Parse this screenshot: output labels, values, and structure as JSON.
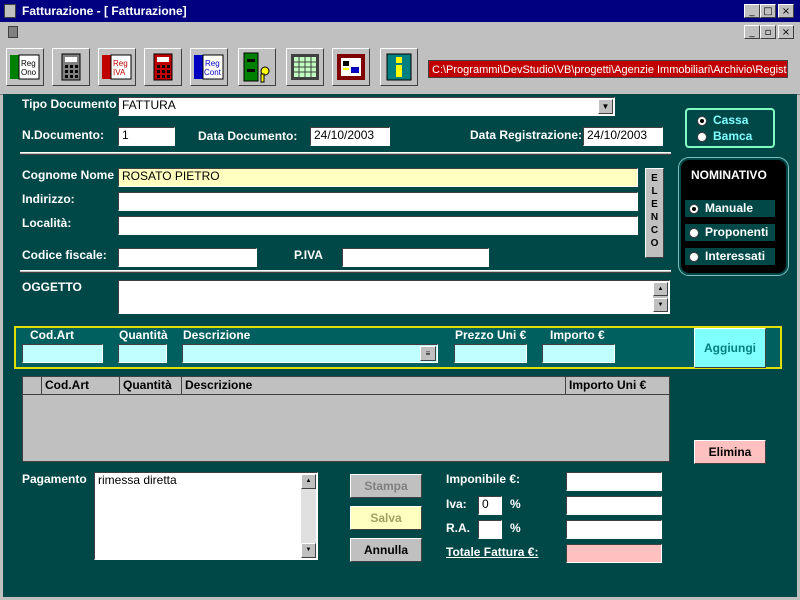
{
  "window": {
    "title": "Fatturazione - [ Fatturazione]",
    "min_glyph": "_",
    "max_glyph": "□",
    "close_glyph": "×",
    "restore_glyph": "▫"
  },
  "toolbar": {
    "path": "C:\\Programmi\\DevStudio\\VB\\progetti\\Agenzie Immobiliari\\Archivio\\Registr",
    "buttons": [
      {
        "name": "reg-ono",
        "label": "Reg Ono"
      },
      {
        "name": "calculator",
        "label": ""
      },
      {
        "name": "reg-iva",
        "label": "Reg IVA"
      },
      {
        "name": "calculator-red",
        "label": ""
      },
      {
        "name": "reg-cont",
        "label": "Reg Cont"
      },
      {
        "name": "archive",
        "label": ""
      },
      {
        "name": "calendar",
        "label": ""
      },
      {
        "name": "report",
        "label": ""
      },
      {
        "name": "info",
        "label": ""
      }
    ]
  },
  "header": {
    "tipo_documento_label": "Tipo Documento",
    "tipo_documento_value": "FATTURA",
    "n_documento_label": "N.Documento:",
    "n_documento_value": "1",
    "data_documento_label": "Data Documento:",
    "data_documento_value": "24/10/2003",
    "data_registrazione_label": "Data Registrazione:",
    "data_registrazione_value": "24/10/2003",
    "cassa_label": "Cassa",
    "banca_label": "Bamca"
  },
  "client": {
    "cognome_nome_label": "Cognome Nome",
    "cognome_nome_value": "ROSATO PIETRO",
    "indirizzo_label": "Indirizzo:",
    "localita_label": "Località:",
    "codice_fiscale_label": "Codice fiscale:",
    "piva_label": "P.IVA",
    "elenco_label": "ELENCO"
  },
  "nominativo": {
    "title": "NOMINATIVO",
    "options": [
      "Manuale",
      "Proponenti",
      "Interessati"
    ]
  },
  "oggetto": {
    "label": "OGGETTO"
  },
  "item_entry": {
    "cod_art_label": "Cod.Art",
    "quantita_label": "Quantità",
    "descrizione_label": "Descrizione",
    "prezzo_label": "Prezzo Uni €",
    "importo_label": "Importo €",
    "aggiungi_label": "Aggiungi"
  },
  "grid": {
    "columns": [
      "Cod.Art",
      "Quantità",
      "Descrizione",
      "Importo Uni €"
    ],
    "rows": []
  },
  "actions": {
    "elimina_label": "Elimina",
    "stampa_label": "Stampa",
    "salva_label": "Salva",
    "annulla_label": "Annulla"
  },
  "pagamento": {
    "label": "Pagamento",
    "value": "rimessa diretta"
  },
  "totals": {
    "imponibile_label": "Imponibile €:",
    "iva_label": "Iva:",
    "iva_value": "0",
    "ra_label": "R.A.",
    "percent": "%",
    "totale_label": "Totale Fattura €:"
  }
}
